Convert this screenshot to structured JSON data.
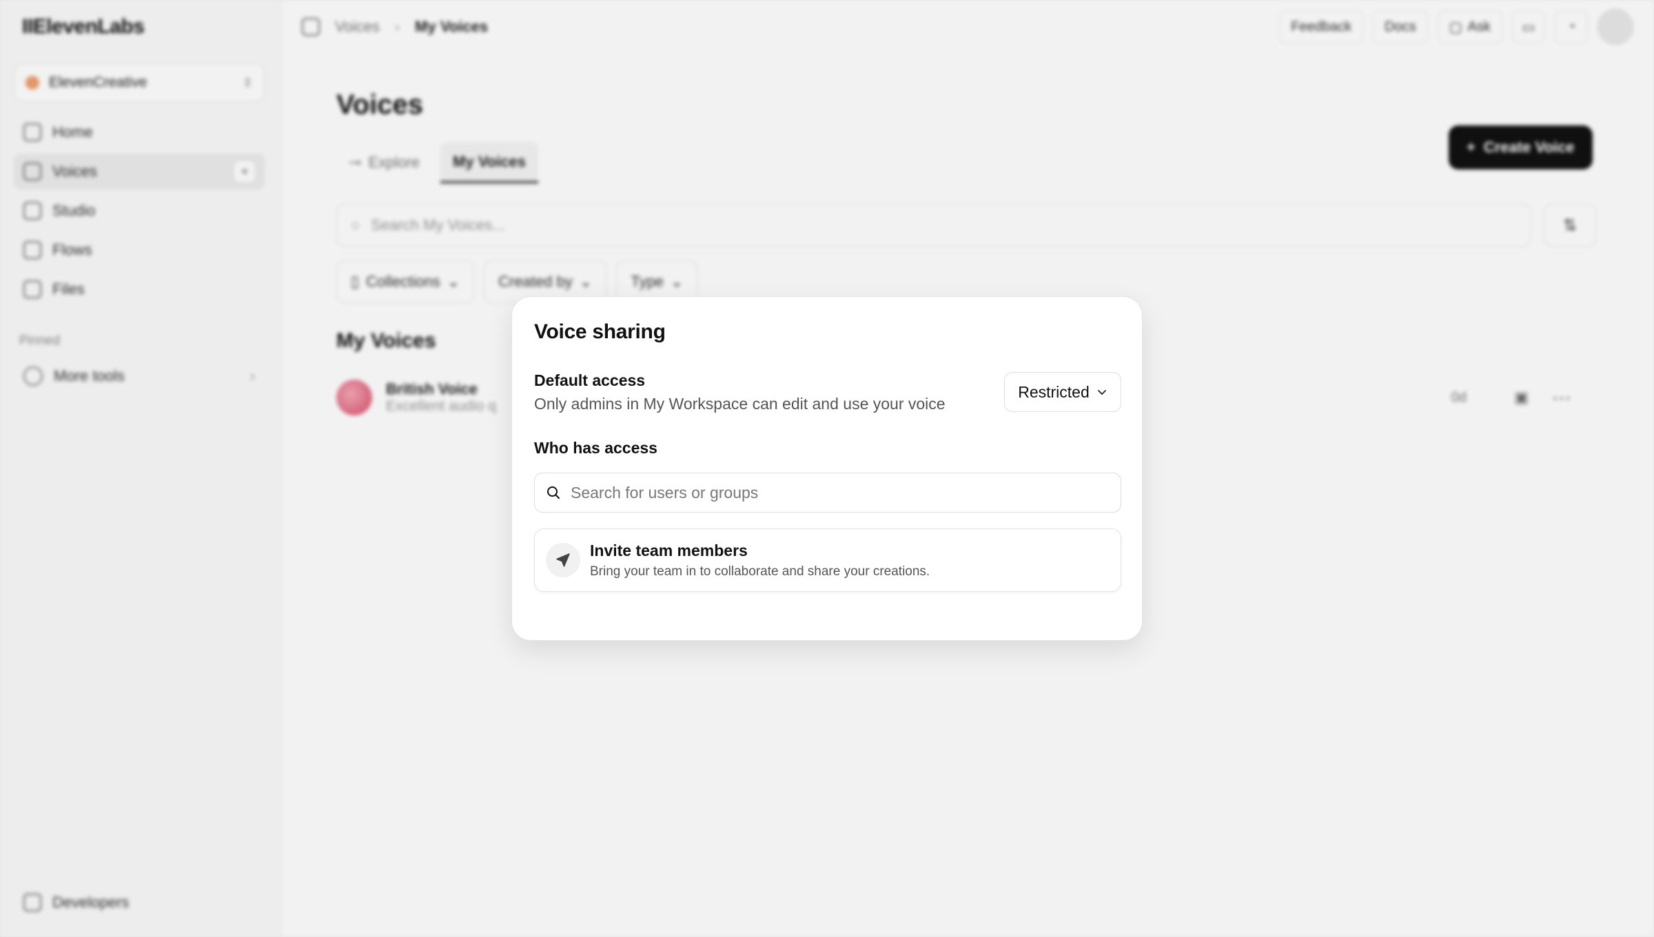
{
  "app": {
    "logo": "IIElevenLabs",
    "workspace": "ElevenCreative"
  },
  "sidebar": {
    "items": [
      {
        "label": "Home",
        "icon": "home-icon"
      },
      {
        "label": "Voices",
        "icon": "voices-grid-icon",
        "active": true
      },
      {
        "label": "Studio",
        "icon": "studio-icon"
      },
      {
        "label": "Flows",
        "icon": "flows-icon"
      },
      {
        "label": "Files",
        "icon": "files-icon"
      }
    ],
    "pinned_label": "Pinned",
    "more_tools": "More tools",
    "developers": "Developers"
  },
  "topbar": {
    "breadcrumb": [
      "Voices",
      "My Voices"
    ],
    "feedback": "Feedback",
    "docs": "Docs",
    "ask": "Ask"
  },
  "main": {
    "title": "Voices",
    "tabs": [
      {
        "label": "Explore"
      },
      {
        "label": "My Voices",
        "active": true
      }
    ],
    "create_button": "Create Voice",
    "search_placeholder": "Search My Voices...",
    "filters": [
      "Collections",
      "Created by",
      "Type"
    ],
    "section_title": "My Voices",
    "voices": [
      {
        "name": "British Voice",
        "description": "Excellent audio q",
        "age": "0d"
      }
    ]
  },
  "dialog": {
    "title": "Voice sharing",
    "default_access_label": "Default access",
    "default_access_desc": "Only admins in My Workspace can edit and use your voice",
    "access_value": "Restricted",
    "who_label": "Who has access",
    "search_placeholder": "Search for users or groups",
    "invite_title": "Invite team members",
    "invite_desc": "Bring your team in to collaborate and share your creations."
  }
}
